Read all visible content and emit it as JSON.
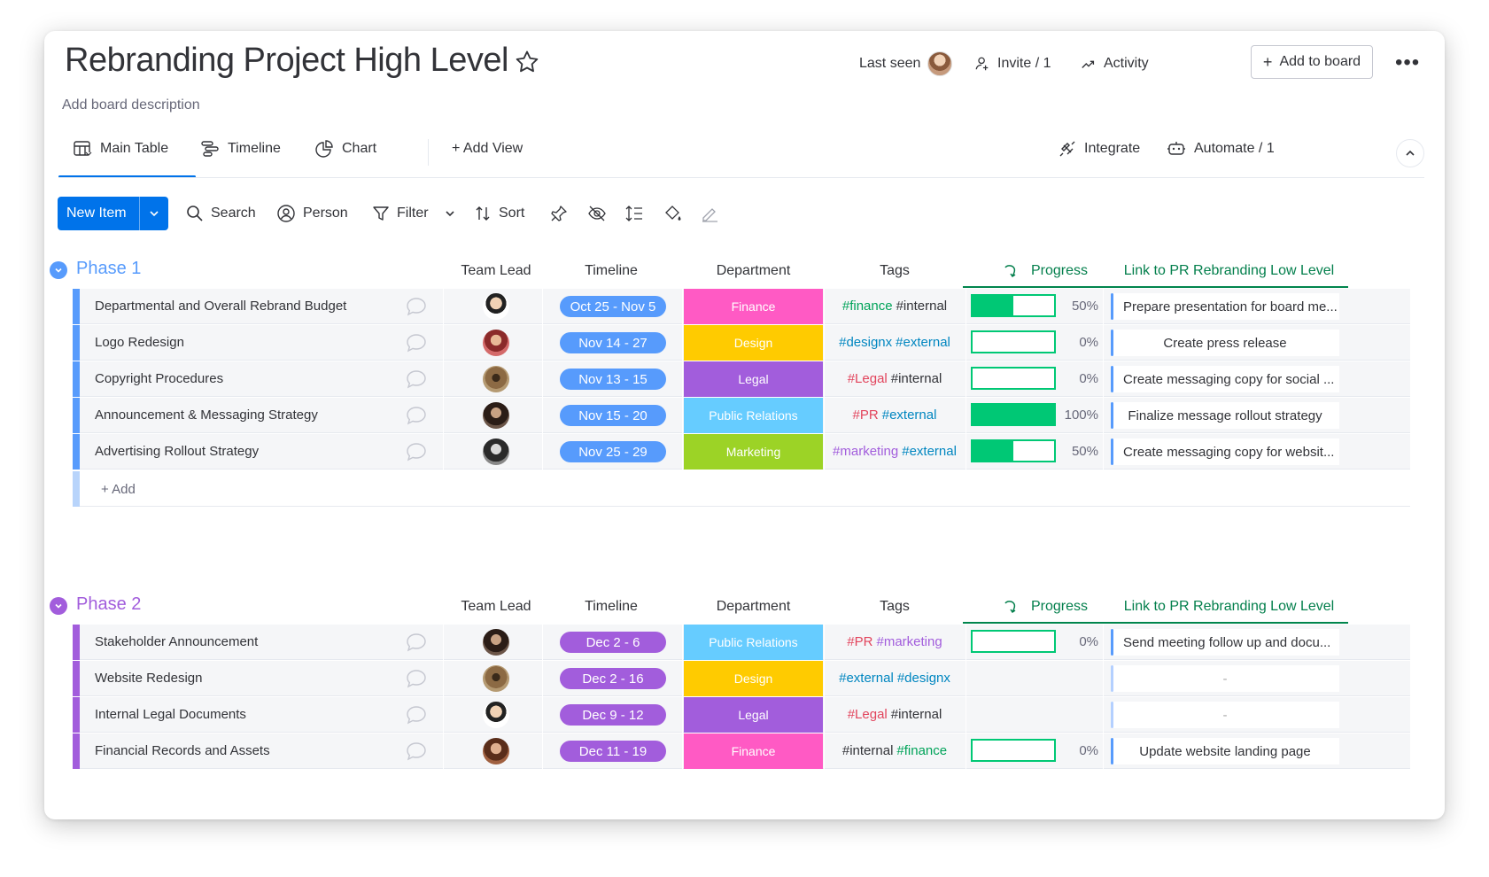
{
  "board": {
    "title": "Rebranding Project High Level",
    "description": "Add board description"
  },
  "header": {
    "last_seen": "Last seen",
    "invite": "Invite / 1",
    "activity": "Activity",
    "add_to_board": "Add to board",
    "more": "•••"
  },
  "tabs": [
    {
      "label": "Main Table",
      "icon": "table-icon",
      "active": true
    },
    {
      "label": "Timeline",
      "icon": "timeline-icon"
    },
    {
      "label": "Chart",
      "icon": "chart-icon"
    },
    {
      "label": "+  Add View",
      "icon": "plus-icon"
    }
  ],
  "integrations": {
    "integrate": "Integrate",
    "automate": "Automate / 1"
  },
  "toolbar": {
    "new_item": "New Item",
    "search": "Search",
    "person": "Person",
    "filter": "Filter",
    "sort": "Sort"
  },
  "columns": {
    "team_lead": "Team Lead",
    "timeline": "Timeline",
    "department": "Department",
    "tags": "Tags",
    "progress": "Progress",
    "link": "Link to PR Rebranding Low Level"
  },
  "colors": {
    "primary": "#0073ea",
    "phase1": "#579bfc",
    "phase2": "#a25ddc",
    "finance": "#ff5ac4",
    "design": "#ffcb00",
    "legal": "#a25ddc",
    "public_relations": "#66ccff",
    "marketing": "#9cd326",
    "progress": "#00c875"
  },
  "groups": [
    {
      "title": "Phase 1",
      "add_label": "+ Add",
      "rows": [
        {
          "name": "Departmental and Overall Rebrand Budget",
          "timeline": "Oct 25 - Nov 5",
          "department": "Finance",
          "tags": [
            "#finance",
            "#internal"
          ],
          "progress": 50,
          "progress_label": "50%",
          "link": "Prepare presentation for board me..."
        },
        {
          "name": "Logo Redesign",
          "timeline": "Nov 14 - 27",
          "department": "Design",
          "tags": [
            "#designx",
            "#external"
          ],
          "progress": 0,
          "progress_label": "0%",
          "link": "Create press release"
        },
        {
          "name": "Copyright Procedures",
          "timeline": "Nov 13 - 15",
          "department": "Legal",
          "tags": [
            "#Legal",
            "#internal"
          ],
          "progress": 0,
          "progress_label": "0%",
          "link": "Create messaging copy for social ..."
        },
        {
          "name": "Announcement & Messaging Strategy",
          "timeline": "Nov 15 - 20",
          "department": "Public Relations",
          "tags": [
            "#PR",
            "#external"
          ],
          "progress": 100,
          "progress_label": "100%",
          "link": "Finalize message rollout strategy"
        },
        {
          "name": "Advertising Rollout Strategy",
          "timeline": "Nov 25 - 29",
          "department": "Marketing",
          "tags": [
            "#marketing",
            "#external"
          ],
          "progress": 50,
          "progress_label": "50%",
          "link": "Create messaging copy for websit..."
        }
      ]
    },
    {
      "title": "Phase 2",
      "rows": [
        {
          "name": "Stakeholder Announcement",
          "timeline": "Dec 2 - 6",
          "department": "Public Relations",
          "tags": [
            "#PR",
            "#marketing"
          ],
          "progress": 0,
          "progress_label": "0%",
          "link": "Send meeting follow up and docu..."
        },
        {
          "name": "Website Redesign",
          "timeline": "Dec 2 - 16",
          "department": "Design",
          "tags": [
            "#external",
            "#designx"
          ],
          "progress": null,
          "progress_label": "",
          "link": "-"
        },
        {
          "name": "Internal Legal Documents",
          "timeline": "Dec 9 - 12",
          "department": "Legal",
          "tags": [
            "#Legal",
            "#internal"
          ],
          "progress": null,
          "progress_label": "",
          "link": "-"
        },
        {
          "name": "Financial Records and Assets",
          "timeline": "Dec 11 - 19",
          "department": "Finance",
          "tags": [
            "#internal",
            "#finance"
          ],
          "progress": 0,
          "progress_label": "0%",
          "link": "Update website landing page"
        }
      ]
    }
  ]
}
